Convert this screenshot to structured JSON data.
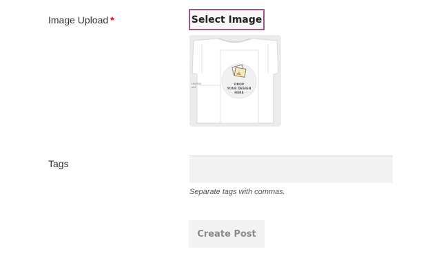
{
  "image_upload": {
    "label": "Image Upload",
    "required_marker": "*",
    "select_button": "Select Image",
    "preview": {
      "drop_text_lines": [
        "DROP",
        "YOUR DESIGN",
        "HERE"
      ],
      "side_text_lines": [
        "LIN PUB",
        "ard"
      ]
    }
  },
  "tags": {
    "label": "Tags",
    "value": "",
    "help": "Separate tags with commas."
  },
  "submit": {
    "label": "Create Post"
  },
  "colors": {
    "select_border": "#96588a",
    "required": "#d0021b"
  }
}
